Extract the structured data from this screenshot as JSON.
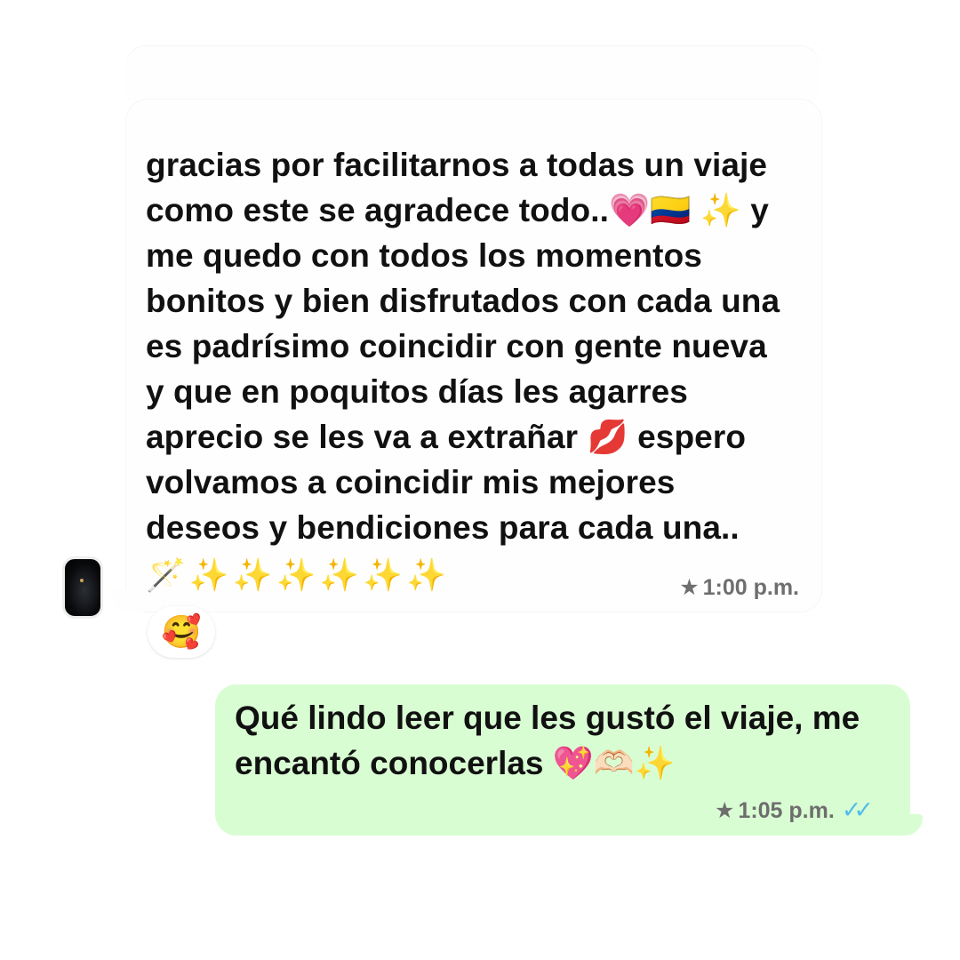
{
  "incoming_message": {
    "line1": "gracias por facilitarnos a todas un viaje",
    "line2_text": "como este se agradece todo..",
    "line2_emojis": "💗🇨🇴 ✨",
    "line2_tail": " y",
    "line3": "me quedo con todos los momentos",
    "line4": "bonitos y bien disfrutados con cada una",
    "line5": "es padrísimo coincidir con gente nueva",
    "line6": "y que en poquitos días les agarres",
    "line7_text": "aprecio se les va a extrañar ",
    "line7_emoji": "💋",
    "line7_tail": " espero",
    "line8": "volvamos a coincidir mis mejores",
    "line9": "deseos y bendiciones para cada una..",
    "sparkles": "🪄✨✨✨✨✨✨",
    "star_icon": "★",
    "time": "1:00 p.m.",
    "reaction": "🥰"
  },
  "outgoing_message": {
    "line1": "Qué lindo leer que les gustó el viaje, me",
    "line2_text": "encantó conocerlas ",
    "line2_emojis": "💖🫶🏻✨",
    "star_icon": "★",
    "time": "1:05 p.m.",
    "read_ticks": "✓✓",
    "read_color": "#53bdeb"
  },
  "colors": {
    "outgoing_bubble": "#d9fdd3",
    "incoming_bubble": "#fefefe",
    "meta_text": "#6e6e6e"
  },
  "icons": {
    "avatar": "avatar-photo",
    "star": "star-icon",
    "ticks": "double-check-icon"
  }
}
